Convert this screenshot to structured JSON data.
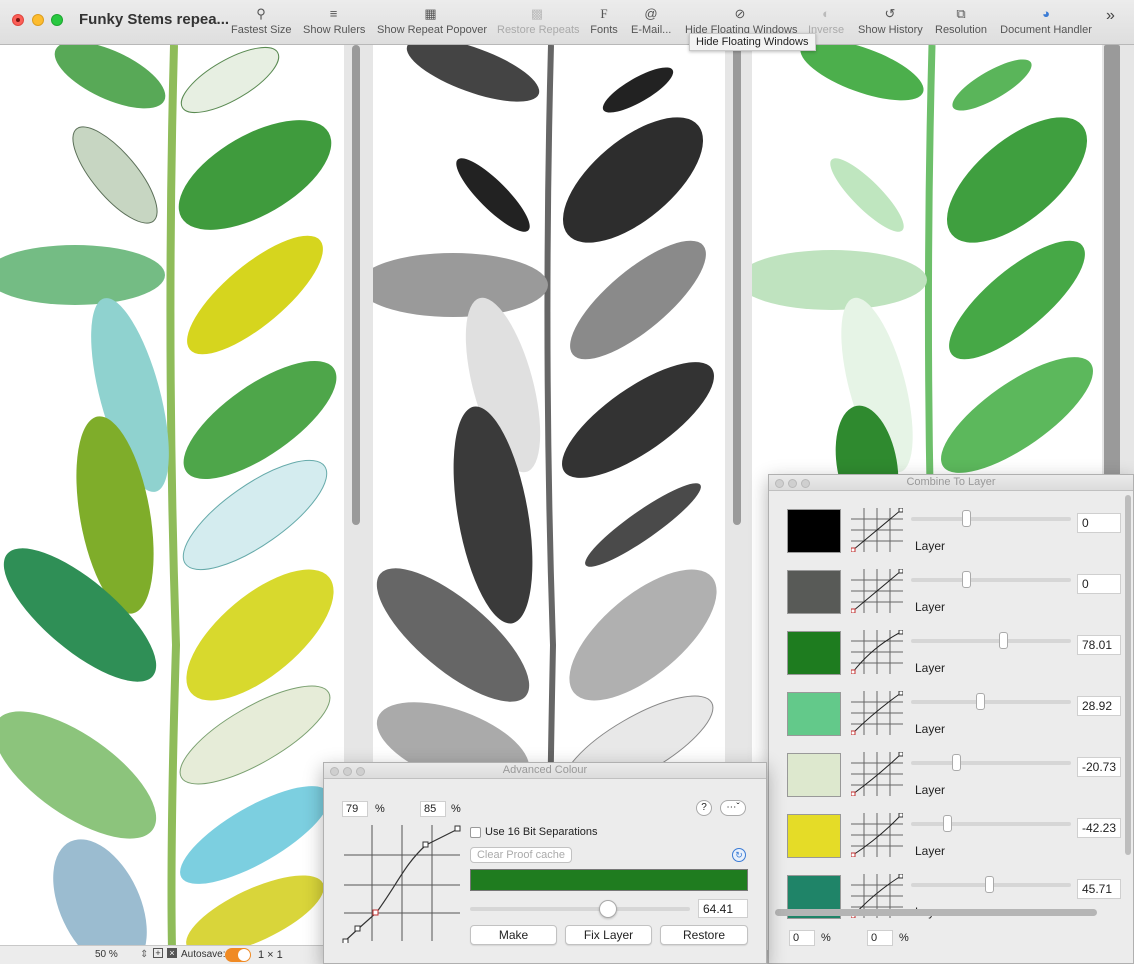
{
  "window": {
    "title": "Funky Stems repea..."
  },
  "toolbar": {
    "items": [
      {
        "label": "Fastest Size",
        "icon": "zoom-icon"
      },
      {
        "label": "Show Rulers",
        "icon": "rulers-icon"
      },
      {
        "label": "Show Repeat Popover",
        "icon": "repeat-icon"
      },
      {
        "label": "Restore Repeats",
        "icon": "restore-icon",
        "disabled": true
      },
      {
        "label": "Fonts",
        "icon": "fonts-icon"
      },
      {
        "label": "E-Mail...",
        "icon": "email-icon"
      },
      {
        "label": "Hide Floating Windows",
        "icon": "eye-icon"
      },
      {
        "label": "Inverse",
        "icon": "inverse-icon",
        "disabled": true
      },
      {
        "label": "Show History",
        "icon": "history-icon"
      },
      {
        "label": "Resolution",
        "icon": "resolution-icon"
      },
      {
        "label": "Document Handler",
        "icon": "document-handler-icon"
      }
    ],
    "tooltip": "Hide Floating Windows"
  },
  "status": {
    "zoom": "50 %",
    "autosave_label": "Autosave:",
    "repeat": "1 × 1"
  },
  "combine": {
    "title": "Combine To Layer",
    "rows": [
      {
        "color": "#000000",
        "label": "Layer",
        "value": "0",
        "level": 0.34
      },
      {
        "color": "#585a57",
        "label": "Layer",
        "value": "0",
        "level": 0.34
      },
      {
        "color": "#1e7c1f",
        "label": "Layer",
        "value": "78.01",
        "level": 0.58
      },
      {
        "color": "#63c98a",
        "label": "Layer",
        "value": "28.92",
        "level": 0.43
      },
      {
        "color": "#dde8ce",
        "label": "Layer",
        "value": "-20.73",
        "level": 0.27
      },
      {
        "color": "#e5dc27",
        "label": "Layer",
        "value": "-42.23",
        "level": 0.21
      },
      {
        "color": "#1f8468",
        "label": "Layer",
        "value": "45.71",
        "level": 0.49
      }
    ],
    "pct_a": "0",
    "pct_b": "0",
    "pct_unit": "%"
  },
  "advanced": {
    "title": "Advanced Colour",
    "left_pct": "79",
    "right_pct": "85",
    "pct_unit": "%",
    "help": "?",
    "use16": "Use 16 Bit Separations",
    "clear_cache": "Clear Proof cache",
    "swatch_color": "#1f7c1f",
    "slider_value": "64.41",
    "slider_level": 0.64,
    "buttons": {
      "make": "Make",
      "fix": "Fix Layer",
      "restore": "Restore"
    }
  }
}
